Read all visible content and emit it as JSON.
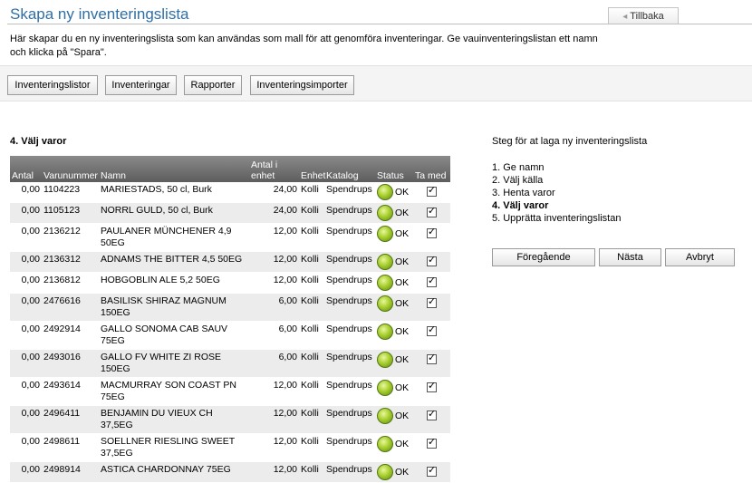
{
  "header": {
    "title": "Skapa ny inventeringslista",
    "back_label": "Tillbaka"
  },
  "intro": {
    "line1": "Här skapar du en ny inventeringslista som kan användas som mall för att genomföra inventeringar. Ge vauinventeringslistan ett namn",
    "line2": "och klicka på \"Spara\"."
  },
  "nav": {
    "buttons": [
      "Inventeringslistor",
      "Inventeringar",
      "Rapporter",
      "Inventeringsimporter"
    ]
  },
  "section": {
    "title": "4. Välj varor"
  },
  "table": {
    "headers": {
      "antal": "Antal",
      "varunummer": "Varunummer",
      "namn": "Namn",
      "antal_i_enhet": "Antal i enhet",
      "enhet": "Enhet",
      "katalog": "Katalog",
      "status": "Status",
      "ta_med": "Ta med"
    },
    "rows": [
      {
        "antal": "0,00",
        "varunummer": "1104223",
        "namn": "MARIESTADS, 50 cl, Burk",
        "antal_i_enhet": "24,00",
        "enhet": "Kolli",
        "katalog": "Spendrups",
        "status": "OK",
        "ta_med": true
      },
      {
        "antal": "0,00",
        "varunummer": "1105123",
        "namn": "NORRL GULD, 50 cl, Burk",
        "antal_i_enhet": "24,00",
        "enhet": "Kolli",
        "katalog": "Spendrups",
        "status": "OK",
        "ta_med": true
      },
      {
        "antal": "0,00",
        "varunummer": "2136212",
        "namn": "PAULANER MÜNCHENER 4,9 50EG",
        "antal_i_enhet": "12,00",
        "enhet": "Kolli",
        "katalog": "Spendrups",
        "status": "OK",
        "ta_med": true
      },
      {
        "antal": "0,00",
        "varunummer": "2136312",
        "namn": "ADNAMS THE BITTER 4,5 50EG",
        "antal_i_enhet": "12,00",
        "enhet": "Kolli",
        "katalog": "Spendrups",
        "status": "OK",
        "ta_med": true
      },
      {
        "antal": "0,00",
        "varunummer": "2136812",
        "namn": "HOBGOBLIN ALE 5,2 50EG",
        "antal_i_enhet": "12,00",
        "enhet": "Kolli",
        "katalog": "Spendrups",
        "status": "OK",
        "ta_med": true
      },
      {
        "antal": "0,00",
        "varunummer": "2476616",
        "namn": "BASILISK SHIRAZ MAGNUM 150EG",
        "antal_i_enhet": "6,00",
        "enhet": "Kolli",
        "katalog": "Spendrups",
        "status": "OK",
        "ta_med": true
      },
      {
        "antal": "0,00",
        "varunummer": "2492914",
        "namn": "GALLO SONOMA CAB SAUV 75EG",
        "antal_i_enhet": "6,00",
        "enhet": "Kolli",
        "katalog": "Spendrups",
        "status": "OK",
        "ta_med": true
      },
      {
        "antal": "0,00",
        "varunummer": "2493016",
        "namn": "GALLO FV WHITE ZI ROSE 150EG",
        "antal_i_enhet": "6,00",
        "enhet": "Kolli",
        "katalog": "Spendrups",
        "status": "OK",
        "ta_med": true
      },
      {
        "antal": "0,00",
        "varunummer": "2493614",
        "namn": "MACMURRAY SON COAST PN 75EG",
        "antal_i_enhet": "12,00",
        "enhet": "Kolli",
        "katalog": "Spendrups",
        "status": "OK",
        "ta_med": true
      },
      {
        "antal": "0,00",
        "varunummer": "2496411",
        "namn": "BENJAMIN DU VIEUX CH 37,5EG",
        "antal_i_enhet": "12,00",
        "enhet": "Kolli",
        "katalog": "Spendrups",
        "status": "OK",
        "ta_med": true
      },
      {
        "antal": "0,00",
        "varunummer": "2498611",
        "namn": "SOELLNER RIESLING SWEET 37,5EG",
        "antal_i_enhet": "12,00",
        "enhet": "Kolli",
        "katalog": "Spendrups",
        "status": "OK",
        "ta_med": true
      },
      {
        "antal": "0,00",
        "varunummer": "2498914",
        "namn": "ASTICA CHARDONNAY 75EG",
        "antal_i_enhet": "12,00",
        "enhet": "Kolli",
        "katalog": "Spendrups",
        "status": "OK",
        "ta_med": true
      }
    ]
  },
  "steps": {
    "title": "Steg för at laga ny inventeringslista",
    "items": [
      "1. Ge namn",
      "2. Välj källa",
      "3. Henta varor",
      "4. Välj varor",
      "5. Upprätta inventeringslistan"
    ],
    "current_index": 3
  },
  "wizard": {
    "prev_label": "Föregående",
    "next_label": "Nästa",
    "cancel_label": "Avbryt"
  },
  "colors": {
    "title_blue": "#2f6fa6",
    "header_gray": "#6e6e6e",
    "status_green": "#a9d02e"
  },
  "icons": {
    "status": "status-ok-icon",
    "back": "chevron-left-icon",
    "checkbox": "checkbox-checked-icon"
  }
}
